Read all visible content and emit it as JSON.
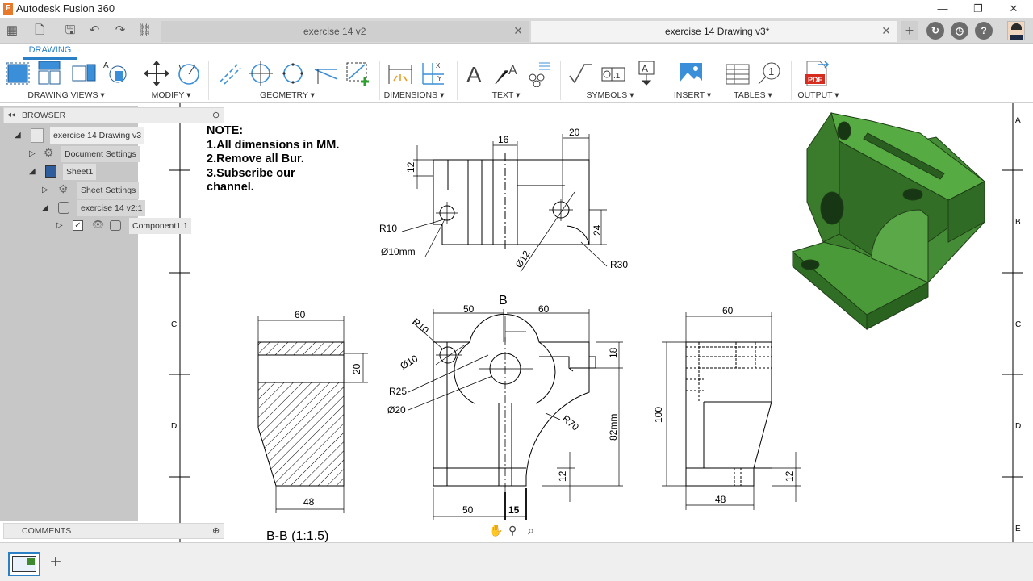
{
  "app": {
    "title": "Autodesk Fusion 360",
    "logo_letter": "F"
  },
  "window": {
    "minimize": "—",
    "restore": "❐",
    "close": "✕"
  },
  "tabs": [
    {
      "label": "exercise 14 v2"
    },
    {
      "label": "exercise 14 Drawing v3*"
    }
  ],
  "toolbar": {
    "workspace_tab": "DRAWING",
    "groups": {
      "drawing_views": "DRAWING VIEWS ▾",
      "modify": "MODIFY ▾",
      "geometry": "GEOMETRY ▾",
      "dimensions": "DIMENSIONS ▾",
      "text": "TEXT ▾",
      "symbols": "SYMBOLS ▾",
      "insert": "INSERT ▾",
      "tables": "TABLES ▾",
      "output": "OUTPUT ▾"
    },
    "pdf_label": "PDF"
  },
  "browser": {
    "header": "BROWSER",
    "items": [
      {
        "label": "exercise 14 Drawing v3"
      },
      {
        "label": "Document Settings"
      },
      {
        "label": "Sheet1"
      },
      {
        "label": "Sheet Settings"
      },
      {
        "label": "exercise 14 v2:1"
      },
      {
        "label": "Component1:1"
      }
    ]
  },
  "comments": {
    "header": "COMMENTS"
  },
  "note": {
    "title": "NOTE:",
    "lines": [
      "1.All dimensions in MM.",
      "2.Remove all Bur.",
      "3.Subscribe our",
      "channel."
    ]
  },
  "border": {
    "row_labels_left": [
      "C",
      "D"
    ],
    "row_labels_right": [
      "A",
      "B",
      "C",
      "D",
      "E"
    ]
  },
  "dimensions": {
    "top": {
      "w16": "16",
      "w20": "20",
      "h12": "12",
      "r10": "R10",
      "d10mm": "Ø10mm",
      "d12": "Ø12",
      "h24": "24",
      "r30": "R30"
    },
    "front": {
      "label": "B",
      "w50": "50",
      "w60": "60",
      "r10": "R10",
      "d10": "Ø10",
      "r25": "R25",
      "d20": "Ø20",
      "r70": "R70",
      "h18": "18",
      "h82": "82mm",
      "h12": "12",
      "b50": "50",
      "b15": "15"
    },
    "section": {
      "w60": "60",
      "h20": "20",
      "w48": "48",
      "label": "B-B (1:1.5)"
    },
    "side": {
      "w60": "60",
      "h100": "100",
      "h12": "12",
      "w48": "48"
    }
  },
  "colors": {
    "model_green": "#3e8a2f",
    "accent_blue": "#2b7fc7"
  }
}
